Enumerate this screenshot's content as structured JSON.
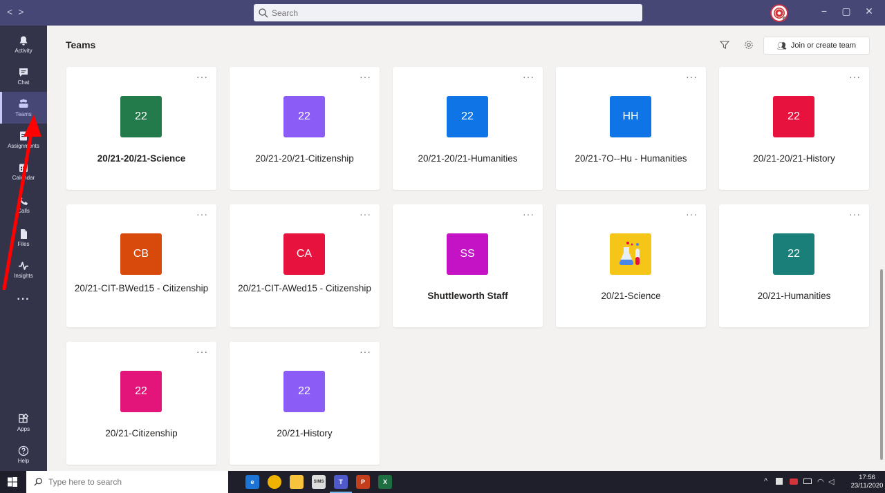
{
  "titlebar": {
    "search_placeholder": "Search",
    "back_icon": "chevron-left-icon",
    "forward_icon": "chevron-right-icon",
    "minimize": "−",
    "maximize": "▢",
    "close": "✕"
  },
  "rail": {
    "items": [
      {
        "label": "Activity",
        "icon": "bell-icon"
      },
      {
        "label": "Chat",
        "icon": "chat-icon"
      },
      {
        "label": "Teams",
        "icon": "teams-icon"
      },
      {
        "label": "Assignments",
        "icon": "assignments-icon"
      },
      {
        "label": "Calendar",
        "icon": "calendar-icon"
      },
      {
        "label": "Calls",
        "icon": "phone-icon"
      },
      {
        "label": "Files",
        "icon": "file-icon"
      },
      {
        "label": "Insights",
        "icon": "pulse-icon"
      }
    ],
    "more": "···",
    "apps_label": "Apps",
    "help_label": "Help"
  },
  "header": {
    "title": "Teams",
    "join_label": "Join or create team"
  },
  "teams": [
    {
      "tile": "22",
      "name": "20/21-20/21-Science",
      "color": "#237b4b",
      "bold": true
    },
    {
      "tile": "22",
      "name": "20/21-20/21-Citizenship",
      "color": "#8b5cf6"
    },
    {
      "tile": "22",
      "name": "20/21-20/21-Humanities",
      "color": "#0f74e6"
    },
    {
      "tile": "HH",
      "name": "20/21-7O--Hu - Humanities",
      "color": "#0f74e6"
    },
    {
      "tile": "22",
      "name": "20/21-20/21-History",
      "color": "#e8123f"
    },
    {
      "tile": "CB",
      "name": "20/21-CIT-BWed15 - Citizenship",
      "color": "#d84a0c",
      "two": true
    },
    {
      "tile": "CA",
      "name": "20/21-CIT-AWed15 - Citizenship",
      "color": "#e8123f",
      "two": true
    },
    {
      "tile": "SS",
      "name": "Shuttleworth Staff",
      "color": "#c413c4",
      "bold": true
    },
    {
      "tile": "",
      "name": "20/21-Science",
      "color": "#f5c518",
      "picture": "science-flask-icon"
    },
    {
      "tile": "22",
      "name": "20/21-Humanities",
      "color": "#1b7f79"
    },
    {
      "tile": "22",
      "name": "20/21-Citizenship",
      "color": "#e3157b"
    },
    {
      "tile": "22",
      "name": "20/21-History",
      "color": "#8b5cf6"
    }
  ],
  "taskbar": {
    "search_placeholder": "Type here to search",
    "apps": [
      {
        "icon": "edge-icon",
        "label": "e",
        "color": "#1b74d6"
      },
      {
        "icon": "chrome-icon",
        "label": "",
        "color": "#f0b400"
      },
      {
        "icon": "file-explorer-icon",
        "label": "",
        "color": "#f8c33c"
      },
      {
        "icon": "sims-icon",
        "label": "SIMS",
        "color": "#dddddd"
      },
      {
        "icon": "teams-app-icon",
        "label": "T",
        "color": "#5059c9"
      },
      {
        "icon": "powerpoint-icon",
        "label": "P",
        "color": "#c43e1c"
      },
      {
        "icon": "excel-icon",
        "label": "X",
        "color": "#1d6f42"
      }
    ],
    "tray_chevron": "^",
    "time": "17:56",
    "date": "23/11/2020"
  }
}
